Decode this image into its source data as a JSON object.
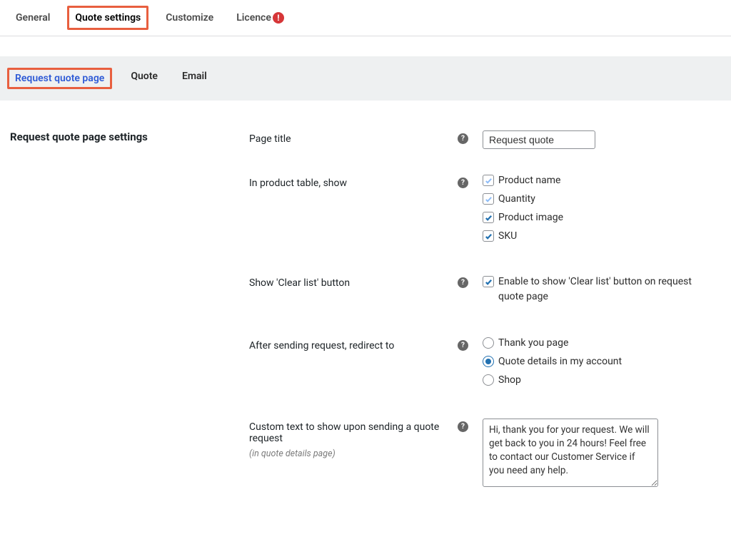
{
  "top_tabs": {
    "general": "General",
    "quote_settings": "Quote settings",
    "customize": "Customize",
    "licence": "Licence"
  },
  "sub_tabs": {
    "request_quote_page": "Request quote page",
    "quote": "Quote",
    "email": "Email"
  },
  "section_heading": "Request quote page settings",
  "fields": {
    "page_title": {
      "label": "Page title",
      "value": "Request quote"
    },
    "product_table": {
      "label": "In product table, show",
      "opts": {
        "name": "Product name",
        "qty": "Quantity",
        "image": "Product image",
        "sku": "SKU"
      }
    },
    "clear_list": {
      "label": "Show 'Clear list' button",
      "desc": "Enable to show 'Clear list' button on request quote page"
    },
    "redirect": {
      "label": "After sending request, redirect to",
      "opts": {
        "thank_you": "Thank you page",
        "quote_details": "Quote details in my account",
        "shop": "Shop"
      }
    },
    "custom_text": {
      "label": "Custom text to show upon sending a quote request",
      "sublabel": "(in quote details page)",
      "value": "Hi, thank you for your request. We will get back to you in 24 hours! Feel free to contact our Customer Service if you need any help."
    }
  }
}
